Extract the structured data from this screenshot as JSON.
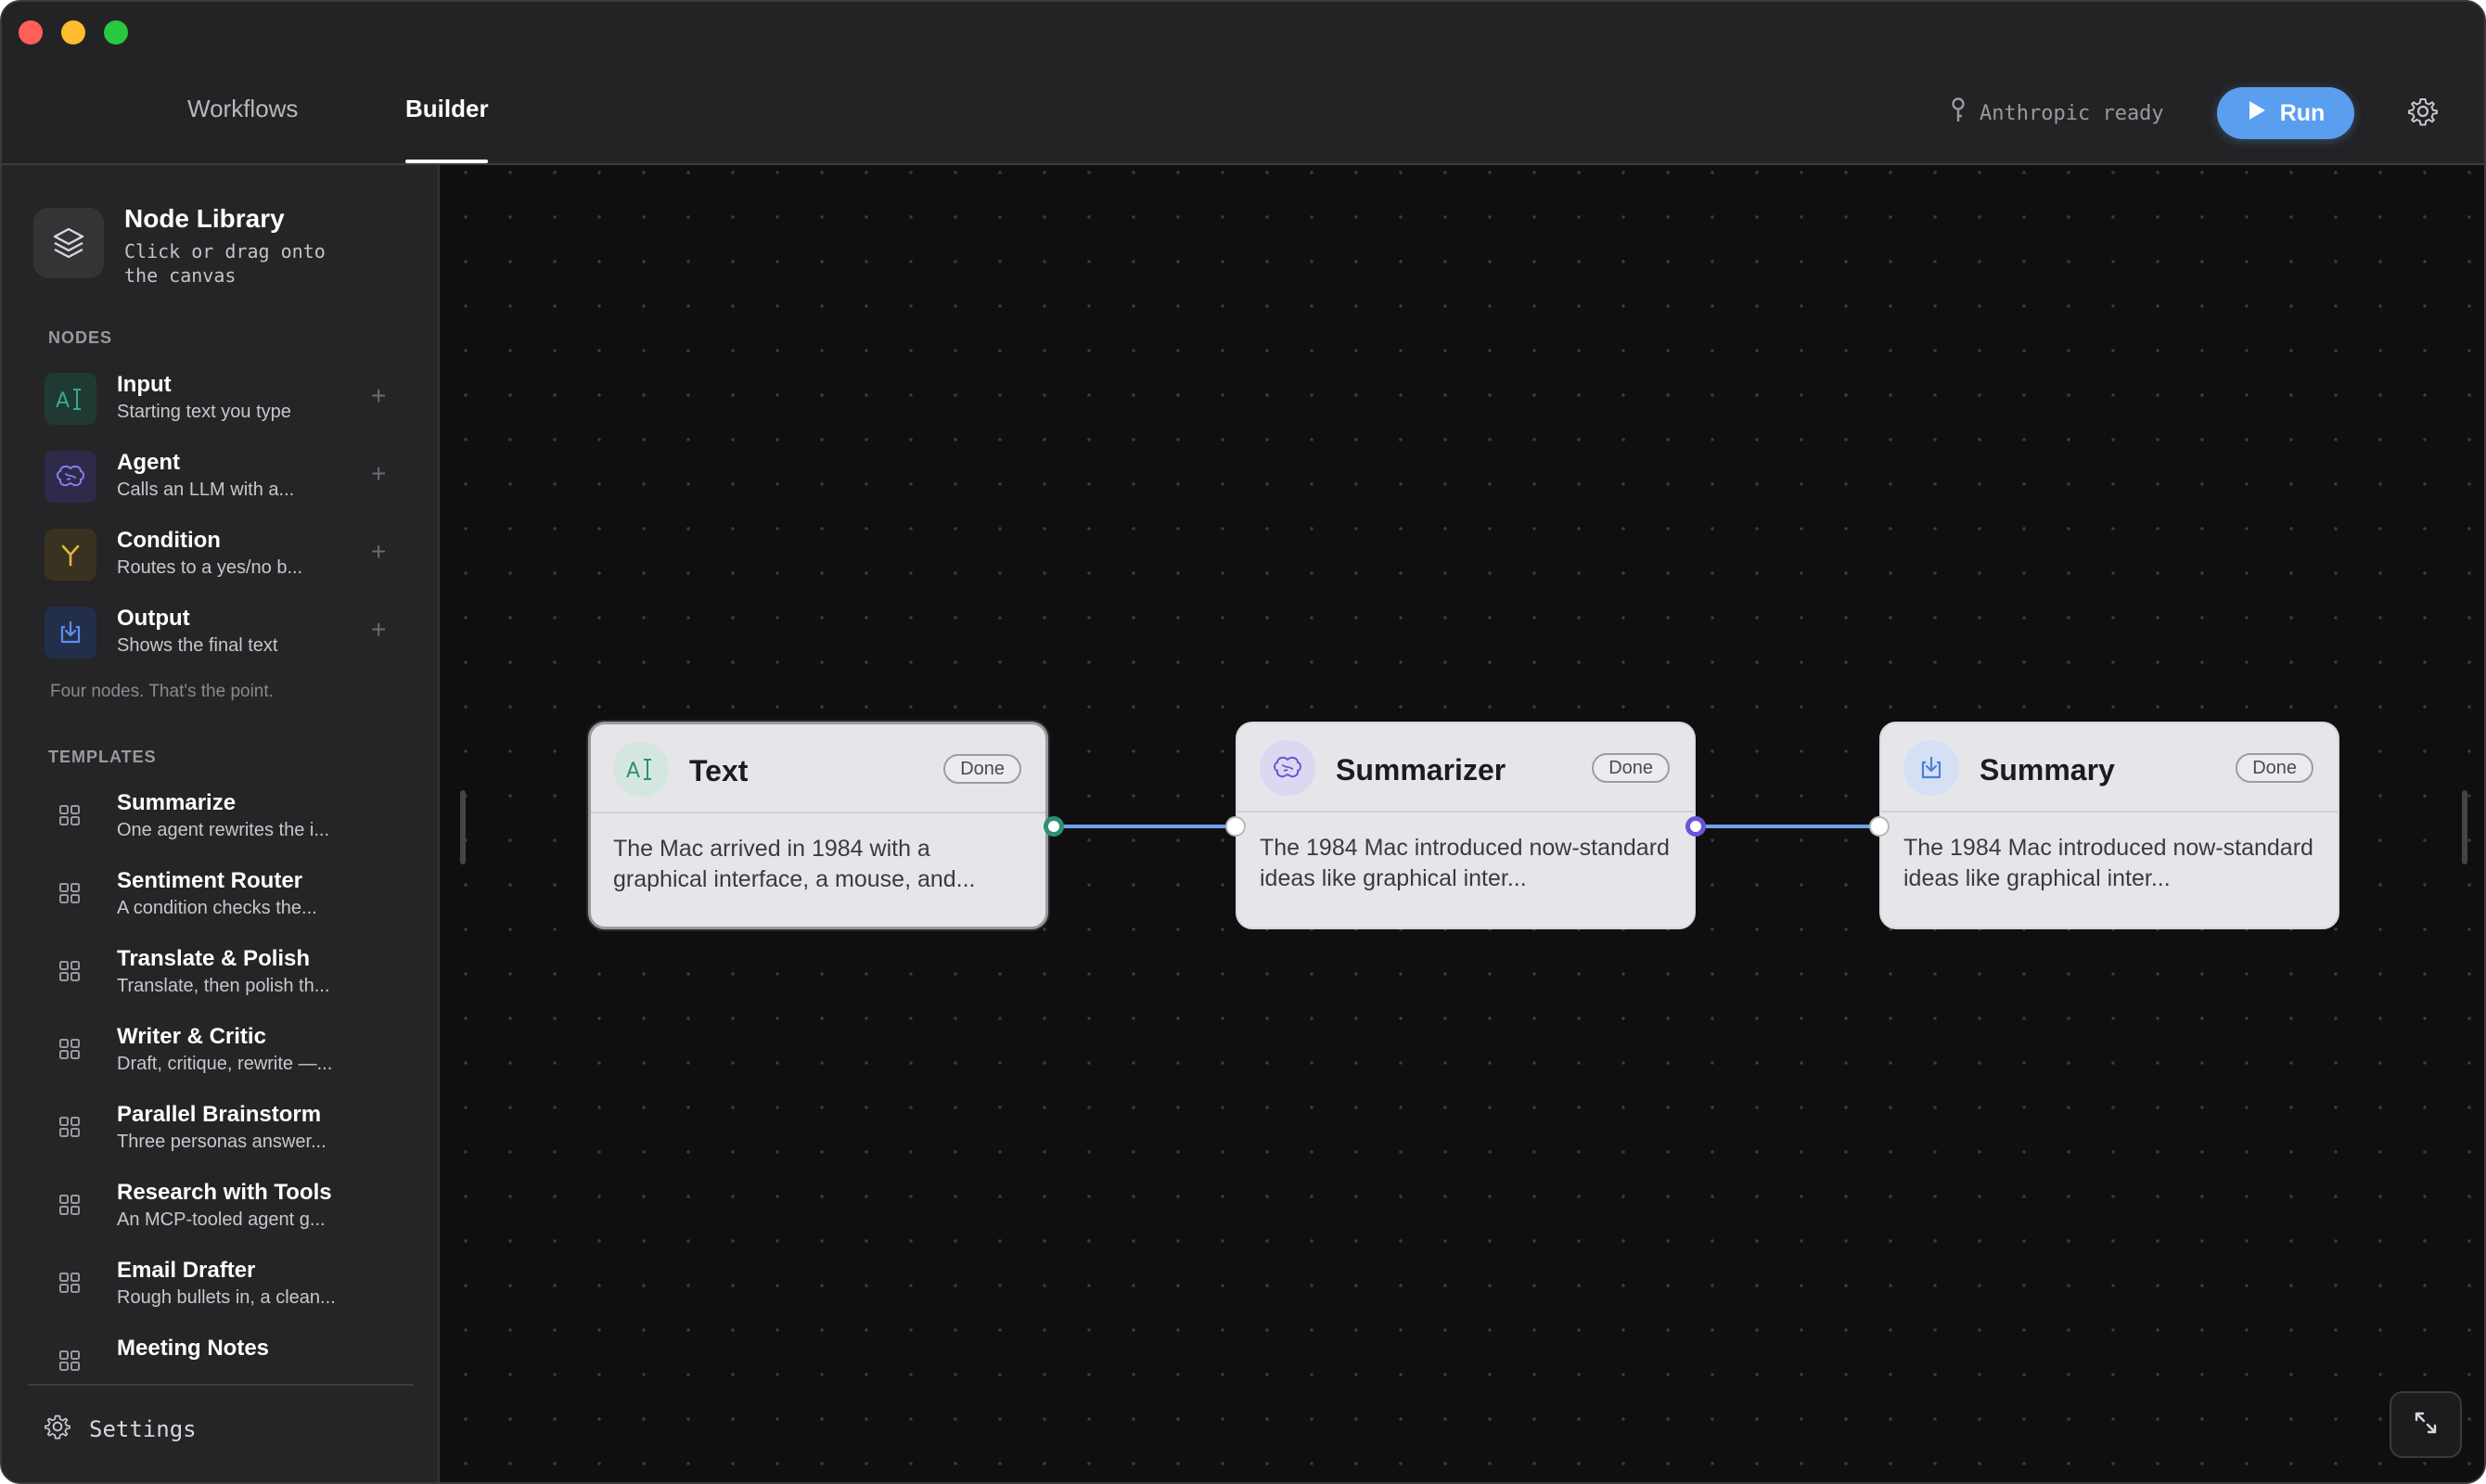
{
  "tabs": {
    "workflows": "Workflows",
    "builder": "Builder"
  },
  "status": {
    "text": "Anthropic ready",
    "icon": "key-icon"
  },
  "run_button": {
    "label": "Run",
    "color": "#5a9ef0"
  },
  "sidebar": {
    "library": {
      "title": "Node Library",
      "subtitle": "Click or drag onto the canvas"
    },
    "nodes_label": "NODES",
    "nodes": [
      {
        "name": "Input",
        "desc": "Starting text you type",
        "icon": "text-cursor-icon",
        "color": "#3aa88a"
      },
      {
        "name": "Agent",
        "desc": "Calls an LLM with a...",
        "icon": "brain-icon",
        "color": "#8a7cf0"
      },
      {
        "name": "Condition",
        "desc": "Routes to a yes/no b...",
        "icon": "branch-icon",
        "color": "#e0b640"
      },
      {
        "name": "Output",
        "desc": "Shows the final text",
        "icon": "download-icon",
        "color": "#5b8ff0"
      }
    ],
    "footnote": "Four nodes. That's the point.",
    "templates_label": "TEMPLATES",
    "templates": [
      {
        "name": "Summarize",
        "desc": "One agent rewrites the i..."
      },
      {
        "name": "Sentiment Router",
        "desc": "A condition checks the..."
      },
      {
        "name": "Translate & Polish",
        "desc": "Translate, then polish th..."
      },
      {
        "name": "Writer & Critic",
        "desc": "Draft, critique, rewrite —..."
      },
      {
        "name": "Parallel Brainstorm",
        "desc": "Three personas answer..."
      },
      {
        "name": "Research with Tools",
        "desc": "An MCP-tooled agent g..."
      },
      {
        "name": "Email Drafter",
        "desc": "Rough bullets in, a clean..."
      },
      {
        "name": "Meeting Notes",
        "desc": ""
      }
    ],
    "settings_label": "Settings"
  },
  "canvas": {
    "nodes": [
      {
        "title": "Text",
        "status": "Done",
        "body": "The Mac arrived in 1984 with a graphical interface, a mouse, and...",
        "icon": "text-cursor-icon"
      },
      {
        "title": "Summarizer",
        "status": "Done",
        "body": "The 1984 Mac introduced now-standard ideas like graphical inter...",
        "icon": "brain-icon"
      },
      {
        "title": "Summary",
        "status": "Done",
        "body": "The 1984 Mac introduced now-standard ideas like graphical inter...",
        "icon": "download-icon"
      }
    ]
  }
}
